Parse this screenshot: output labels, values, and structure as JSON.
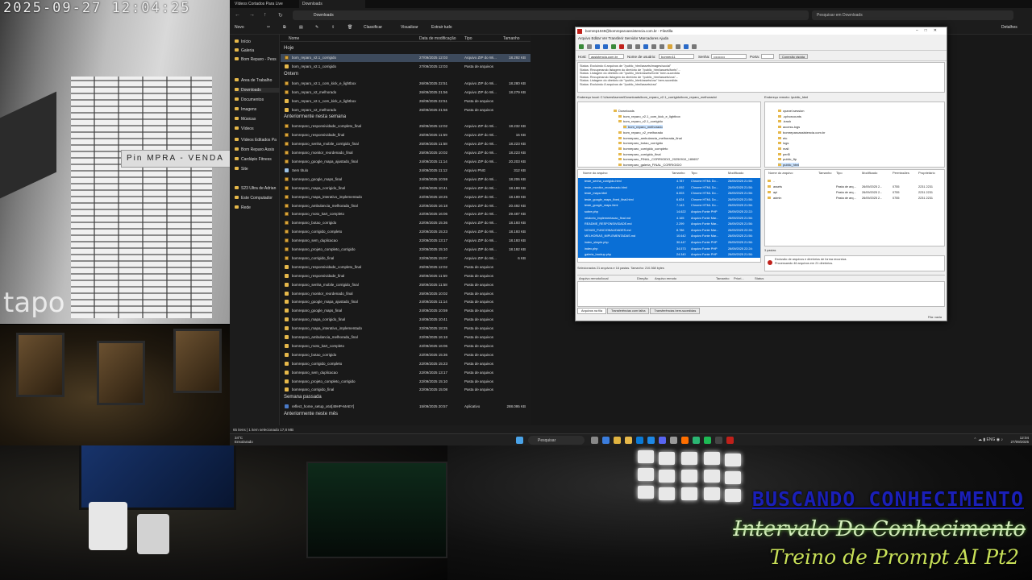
{
  "camera": {
    "timestamp": "2025-09-27 12:04:25",
    "brand": "tapo",
    "signage": "Pin   MPRA - VENDA"
  },
  "overlay": {
    "line1": "BUSCANDO CONHECIMENTO",
    "line2": "Intervalo Do Conhecimento",
    "line3": "Treino de Prompt AI Pt2"
  },
  "explorer": {
    "tabs": [
      "Vídeos Cortados Para Live",
      "Downloads"
    ],
    "address": "Downloads",
    "search_placeholder": "Pesquisar em Downloads",
    "commands": [
      "Novo",
      "Classificar",
      "Visualizar",
      "Extrair tudo",
      "Detalhes"
    ],
    "nav": [
      "Início",
      "Galeria",
      "Bom Reparo - Pess",
      "Área de Trabalho",
      "Downloads",
      "Documentos",
      "Imagens",
      "Músicas",
      "Vídeos",
      "Vídeos Editados Pa",
      "Bom Reparo Assis",
      "Cardápio Fitness",
      "Site",
      "S23 Ultra de Adrian",
      "Este Computador",
      "Rede"
    ],
    "columns": [
      "Nome",
      "Data de modificação",
      "Tipo",
      "Tamanho"
    ],
    "groups": {
      "hoje": "Hoje",
      "ontem": "Ontem",
      "semana": "Anteriormente nesta semana",
      "passada": "Semana passada",
      "mes": "Anteriormente neste mês"
    },
    "rows_hoje": [
      {
        "name": "bom_reparo_v2.1_corrigido",
        "date": "27/09/2025 12:03",
        "type": "Arquivo ZIP do Wi...",
        "size": "18.292 KB",
        "kind": "zip"
      },
      {
        "name": "bom_reparo_v2.1_corrigido",
        "date": "27/09/2025 12:03",
        "type": "Pasta de arquivos",
        "size": "",
        "kind": "folder"
      }
    ],
    "rows_ontem": [
      {
        "name": "bom_reparo_v2.1_com_kick_e_lightbox",
        "date": "26/09/2025 22:51",
        "type": "Arquivo ZIP do Wi...",
        "size": "18.280 KB",
        "kind": "zip"
      },
      {
        "name": "bom_reparo_v2_melhorado",
        "date": "26/09/2025 21:56",
        "type": "Arquivo ZIP do Wi...",
        "size": "18.279 KB",
        "kind": "zip"
      },
      {
        "name": "bom_reparo_v2.1_com_kick_e_lightbox",
        "date": "26/09/2025 22:51",
        "type": "Pasta de arquivos",
        "size": "",
        "kind": "folder"
      },
      {
        "name": "bom_reparo_v2_melhorado",
        "date": "26/09/2025 21:56",
        "type": "Pasta de arquivos",
        "size": "",
        "kind": "folder"
      }
    ],
    "rows_semana": [
      {
        "name": "bomreparo_responsividade_completo_final",
        "date": "25/09/2025 12:02",
        "type": "Arquivo ZIP do Wi...",
        "size": "18.232 KB",
        "kind": "zip"
      },
      {
        "name": "bomreparo_responsividade_final",
        "date": "25/09/2025 11:59",
        "type": "Arquivo ZIP do Wi...",
        "size": "15 KB",
        "kind": "zip"
      },
      {
        "name": "bomreparo_senha_mobile_corrigido_final",
        "date": "25/09/2025 11:58",
        "type": "Arquivo ZIP do Wi...",
        "size": "18.223 KB",
        "kind": "zip"
      },
      {
        "name": "bomreparo_monitor_reordenado_final",
        "date": "25/09/2025 10:02",
        "type": "Arquivo ZIP do Wi...",
        "size": "18.223 KB",
        "kind": "zip"
      },
      {
        "name": "bomreparo_google_mapa_ajustado_final",
        "date": "24/09/2025 11:14",
        "type": "Arquivo ZIP do Wi...",
        "size": "20.203 KB",
        "kind": "zip"
      },
      {
        "name": "Sem título",
        "date": "24/09/2025 11:12",
        "type": "Arquivo PNG",
        "size": "312 KB",
        "kind": "png"
      },
      {
        "name": "bomreparo_google_maps_final",
        "date": "24/09/2025 10:59",
        "type": "Arquivo ZIP do Wi...",
        "size": "18.206 KB",
        "kind": "zip"
      },
      {
        "name": "bomreparo_mapa_corrigido_final",
        "date": "24/09/2025 10:41",
        "type": "Arquivo ZIP do Wi...",
        "size": "18.199 KB",
        "kind": "zip"
      },
      {
        "name": "bomreparo_mapa_interativo_implementado",
        "date": "22/09/2025 18:25",
        "type": "Arquivo ZIP do Wi...",
        "size": "18.199 KB",
        "kind": "zip"
      },
      {
        "name": "bomreparo_ambulancia_melhorada_final",
        "date": "22/09/2025 16:18",
        "type": "Arquivo ZIP do Wi...",
        "size": "20.492 KB",
        "kind": "zip"
      },
      {
        "name": "bomreparo_moto_kart_completo",
        "date": "22/09/2025 16:06",
        "type": "Arquivo ZIP do Wi...",
        "size": "29.487 KB",
        "kind": "zip"
      },
      {
        "name": "bomreparo_botao_corrigido",
        "date": "22/09/2025 15:36",
        "type": "Arquivo ZIP do Wi...",
        "size": "18.193 KB",
        "kind": "zip"
      },
      {
        "name": "bomreparo_corrigido_completo",
        "date": "22/09/2025 15:23",
        "type": "Arquivo ZIP do Wi...",
        "size": "18.193 KB",
        "kind": "zip"
      },
      {
        "name": "bomreparo_sem_duplicacao",
        "date": "22/09/2025 13:17",
        "type": "Arquivo ZIP do Wi...",
        "size": "18.193 KB",
        "kind": "zip"
      },
      {
        "name": "bomreparo_projeto_completo_corrigido",
        "date": "22/09/2025 15:10",
        "type": "Arquivo ZIP do Wi...",
        "size": "18.192 KB",
        "kind": "zip"
      },
      {
        "name": "bomreparo_corrigido_final",
        "date": "22/09/2025 15:07",
        "type": "Arquivo ZIP do Wi...",
        "size": "6 KB",
        "kind": "zip"
      },
      {
        "name": "bomreparo_responsividade_completo_final",
        "date": "25/09/2025 12:02",
        "type": "Pasta de arquivos",
        "size": "",
        "kind": "folder"
      },
      {
        "name": "bomreparo_responsividade_final",
        "date": "25/09/2025 11:59",
        "type": "Pasta de arquivos",
        "size": "",
        "kind": "folder"
      },
      {
        "name": "bomreparo_senha_mobile_corrigido_final",
        "date": "25/09/2025 11:58",
        "type": "Pasta de arquivos",
        "size": "",
        "kind": "folder"
      },
      {
        "name": "bomreparo_monitor_reordenado_final",
        "date": "25/09/2025 10:02",
        "type": "Pasta de arquivos",
        "size": "",
        "kind": "folder"
      },
      {
        "name": "bomreparo_google_mapa_ajustado_final",
        "date": "24/09/2025 11:14",
        "type": "Pasta de arquivos",
        "size": "",
        "kind": "folder"
      },
      {
        "name": "bomreparo_google_maps_final",
        "date": "24/09/2025 10:59",
        "type": "Pasta de arquivos",
        "size": "",
        "kind": "folder"
      },
      {
        "name": "bomreparo_mapa_corrigido_final",
        "date": "24/09/2025 10:41",
        "type": "Pasta de arquivos",
        "size": "",
        "kind": "folder"
      },
      {
        "name": "bomreparo_mapa_interativo_implementado",
        "date": "22/09/2025 18:25",
        "type": "Pasta de arquivos",
        "size": "",
        "kind": "folder"
      },
      {
        "name": "bomreparo_ambulancia_melhorada_final",
        "date": "22/09/2025 16:18",
        "type": "Pasta de arquivos",
        "size": "",
        "kind": "folder"
      },
      {
        "name": "bomreparo_moto_kart_completo",
        "date": "22/09/2025 16:06",
        "type": "Pasta de arquivos",
        "size": "",
        "kind": "folder"
      },
      {
        "name": "bomreparo_botao_corrigido",
        "date": "22/09/2025 15:36",
        "type": "Pasta de arquivos",
        "size": "",
        "kind": "folder"
      },
      {
        "name": "bomreparo_corrigido_completo",
        "date": "22/09/2025 15:23",
        "type": "Pasta de arquivos",
        "size": "",
        "kind": "folder"
      },
      {
        "name": "bomreparo_sem_duplicacao",
        "date": "22/09/2025 13:17",
        "type": "Pasta de arquivos",
        "size": "",
        "kind": "folder"
      },
      {
        "name": "bomreparo_projeto_completo_corrigido",
        "date": "22/09/2025 15:10",
        "type": "Pasta de arquivos",
        "size": "",
        "kind": "folder"
      },
      {
        "name": "bomreparo_corrigido_final",
        "date": "22/09/2025 15:08",
        "type": "Pasta de arquivos",
        "size": "",
        "kind": "folder"
      }
    ],
    "rows_passada": [
      {
        "name": "reflect_home_setup_x64[49HP-MAEY]",
        "date": "15/09/2025 20:57",
        "type": "Aplicativo",
        "size": "288.095 KB",
        "kind": "app"
      }
    ],
    "status": "65 itens  |  1 item selecionado  17,8 MB"
  },
  "taskbar": {
    "weather_temp": "34°C",
    "weather_desc": "Ensolarado",
    "search": "Pesquisar",
    "lang": "ENG",
    "time": "12:04",
    "date": "27/09/2025"
  },
  "filezilla": {
    "title": "bomrep1049@bomreparoassistencia.com.br - FileZilla",
    "menu": "Arquivo   Editar   Ver   Transferir   Servidor   Marcadores   Ajuda",
    "host_label": "Host:",
    "host_value": "assistencia.com.br",
    "user_label": "Nome de usuário:",
    "user_value": "bomrep11",
    "pass_label": "Senha:",
    "pass_value": "••••••••••",
    "port_label": "Porta:",
    "connect": "Conexão rápida",
    "log": [
      "Status:   Excluindo 6 arquivos de \"/public_html/assets/images/social\"",
      "Status:   Recuperando listagem do diretório de \"/public_html/assets/fonts\"...",
      "Status:   Listagem do diretório de \"/public_html/assets/fonts\" bem-sucedida",
      "Status:   Recuperando listagem do diretório de \"/public_html/assets/css\"...",
      "Status:   Listagem do diretório de \"/public_html/assets/css\" bem-sucedida",
      "Status:   Excluindo 8 arquivos de \"/public_html/assets/css\""
    ],
    "local_path": "Endereço local:   C:\\Users\\lazmm\\Downloads\\bom_reparo_v2.1_corrigido\\bom_reparo_melhorado\\",
    "remote_path": "Endereço remoto:   /public_html",
    "local_tree": [
      "Downloads",
      "bom_reparo_v2.1_com_kick_e_lightbox",
      "bom_reparo_v2.1_corrigido",
      "bom_reparo_melhorado",
      "bom_reparo_v2_melhorado",
      "bomreparo_ambulancia_melhorada_final",
      "bomreparo_botao_corrigido",
      "bomreparo_corrigido_completo",
      "bomreparo_corrigido_final",
      "bomreparo_FINAL_CORRIGIDO_20250910_180657",
      "bomreparo_galeria_FINAL_CORRIGIDO"
    ],
    "remote_tree": [
      "cpanel.session",
      ".cphorcounts",
      ".trash",
      "access-logs",
      "bomreparoassistencia.com.br",
      "etc",
      "logs",
      "mail",
      "perl5",
      "public_ftp",
      "public_html"
    ],
    "local_cols": [
      "Nome do arquivo",
      "Tamanho",
      "Tipo",
      "Modificado"
    ],
    "remote_cols": [
      "Nome do arquivo",
      "Tamanho",
      "Tipo",
      "Modificado",
      "Permissões",
      "Proprietário"
    ],
    "local_files": [
      {
        "name": "teste_senha_corrigido.html",
        "size": "4.787",
        "type": "Chrome HTML Do...",
        "mod": "26/09/2025 21:56:"
      },
      {
        "name": "teste_monitor_reordenado.html",
        "size": "4.092",
        "type": "Chrome HTML Do...",
        "mod": "26/09/2025 21:56:"
      },
      {
        "name": "teste_mapa.html",
        "size": "6.003",
        "type": "Chrome HTML Do...",
        "mod": "26/09/2025 21:56:"
      },
      {
        "name": "teste_google_maps_fixed_final.html",
        "size": "6.624",
        "type": "Chrome HTML Do...",
        "mod": "26/09/2025 21:56:"
      },
      {
        "name": "teste_google_maps.html",
        "size": "7.143",
        "type": "Chrome HTML Do...",
        "mod": "26/09/2025 21:56:"
      },
      {
        "name": "sobre.php",
        "size": "14.622",
        "type": "Arquivo Fonte PHP",
        "mod": "26/09/2025 22:22:"
      },
      {
        "name": "relatorio_implementacao_final.md",
        "size": "4.165",
        "type": "Arquivo Fonte Mar...",
        "mod": "26/09/2025 21:56:"
      },
      {
        "name": "README_RESPONSIVIDADE.md",
        "size": "2.299",
        "type": "Arquivo Fonte Mar...",
        "mod": "26/09/2025 21:56:"
      },
      {
        "name": "NOVAS_FUNCIONALIDADES.md",
        "size": "8.786",
        "type": "Arquivo Fonte Mar...",
        "mod": "26/09/2025 22:26:"
      },
      {
        "name": "MELHORIAS_IMPLEMENTADAS.md",
        "size": "10.642",
        "type": "Arquivo Fonte Mar...",
        "mod": "26/09/2025 21:56:"
      },
      {
        "name": "index_simple.php",
        "size": "30.447",
        "type": "Arquivo Fonte PHP",
        "mod": "26/09/2025 21:56:"
      },
      {
        "name": "index.php",
        "size": "34.573",
        "type": "Arquivo Fonte PHP",
        "mod": "26/09/2025 22:24:"
      },
      {
        "name": "galeria_backup.php",
        "size": "24.340",
        "type": "Arquivo Fonte PHP",
        "mod": "26/09/2025 21:56:"
      }
    ],
    "remote_files": [
      {
        "name": "..",
        "size": "",
        "type": "",
        "mod": "",
        "perm": "",
        "own": ""
      },
      {
        "name": "assets",
        "size": "",
        "type": "Pasta de arq...",
        "mod": "26/09/2025 2...",
        "perm": "0755",
        "own": "2231 2231"
      },
      {
        "name": "api",
        "size": "",
        "type": "Pasta de arq...",
        "mod": "26/09/2025 2...",
        "perm": "0755",
        "own": "2231 2231"
      },
      {
        "name": "admin",
        "size": "",
        "type": "Pasta de arq...",
        "mod": "26/09/2025 2...",
        "perm": "0755",
        "own": "2231 2231"
      }
    ],
    "local_summary": "Selecionados 21 arquivos e 16 pastas. Tamanho: 210.368 bytes",
    "remote_summary": "3 pastas",
    "error_lines": [
      "Exclusão de arquivos e diretórios de forma recursiva.",
      "Processando 46 arquivos em 21 diretórios."
    ],
    "queue_cols": [
      "Arquivo remoto/local",
      "Direção",
      "Arquivo remoto",
      "Tamanho",
      "Priori...",
      "Status"
    ],
    "queue_tabs": [
      "Arquivos na fila",
      "Transferências com falha",
      "Transferências bem-sucedidas"
    ],
    "queue_status": "Fila: vazia"
  }
}
